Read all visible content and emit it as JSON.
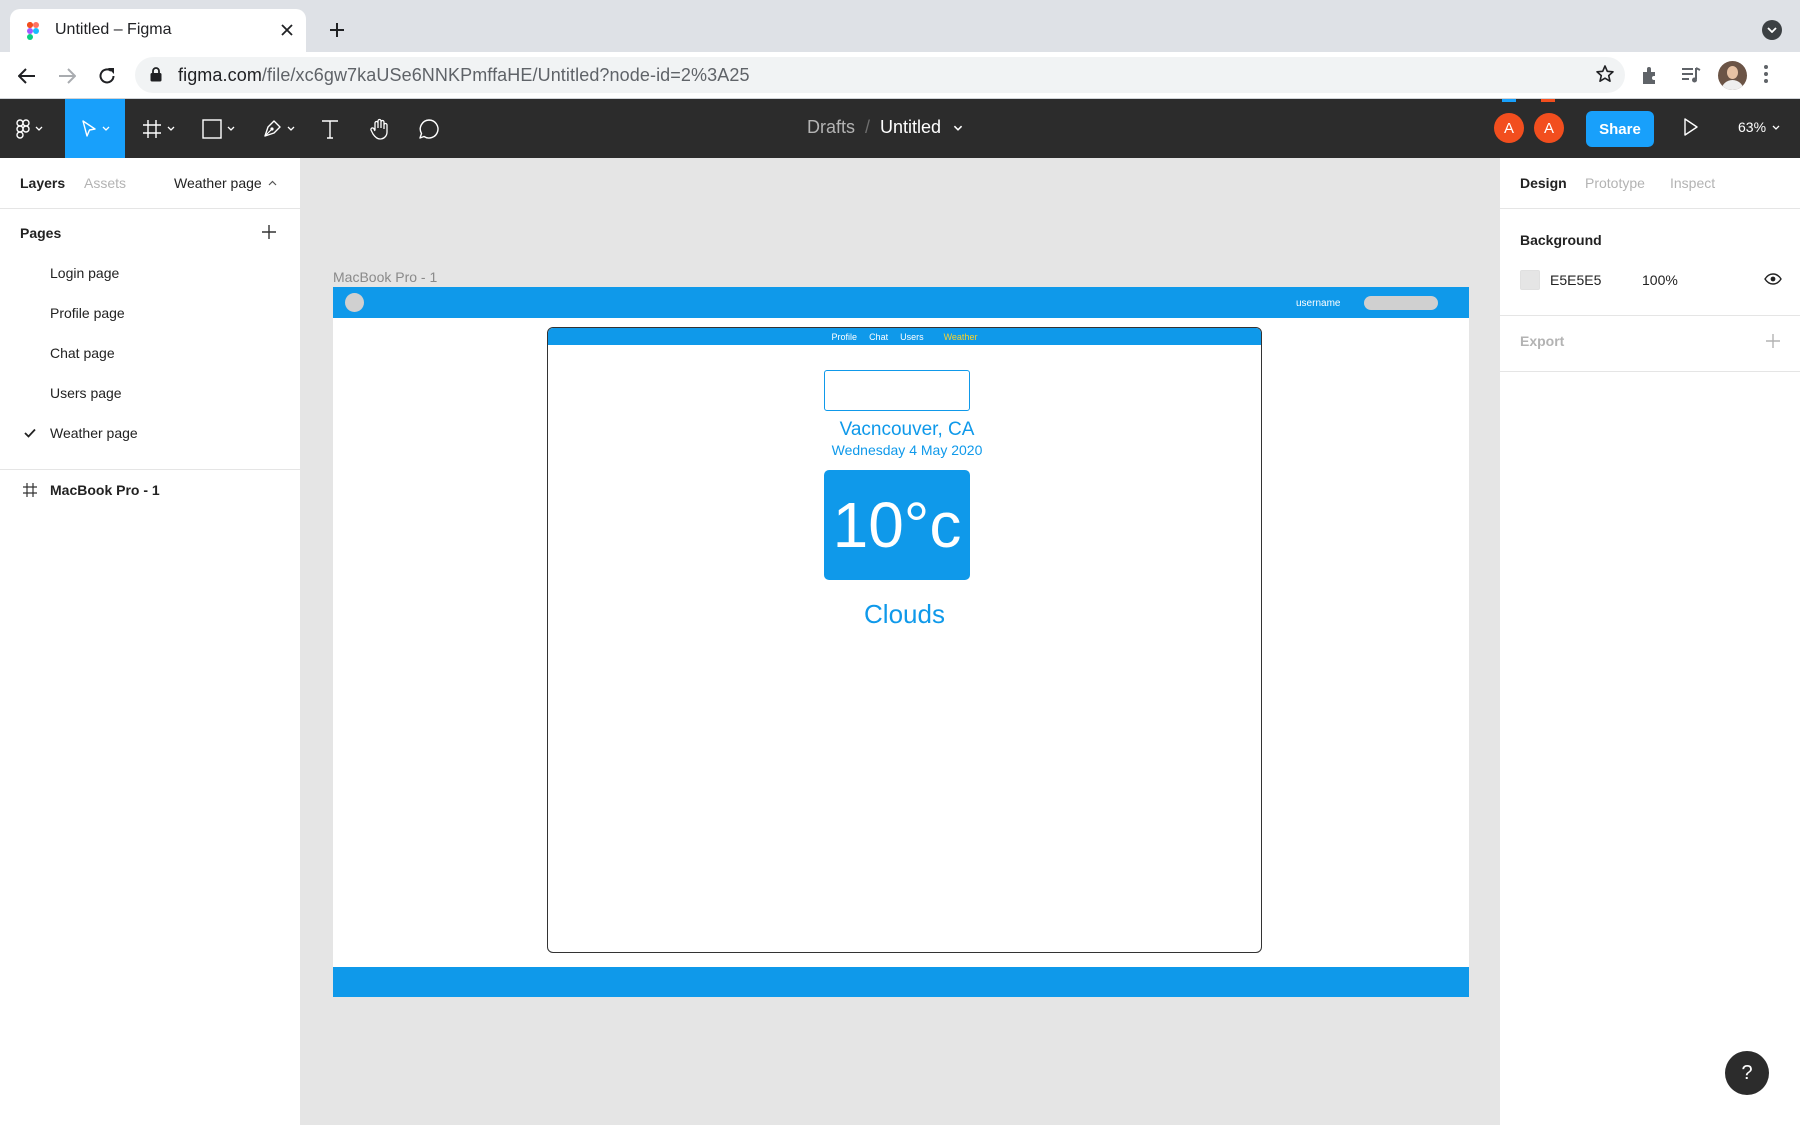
{
  "browser": {
    "tab_title": "Untitled – Figma",
    "url_host": "figma.com",
    "url_path": "/file/xc6gw7kaUSe6NNKPmffaHE/Untitled?node-id=2%3A25"
  },
  "figma_toolbar": {
    "breadcrumb_project": "Drafts",
    "breadcrumb_separator": "/",
    "file_name": "Untitled",
    "avatars": [
      "A",
      "A"
    ],
    "avatar_colors": [
      "#f24e1e",
      "#f24e1e"
    ],
    "avatar_markers": [
      "#18a0fb",
      "#f24e1e"
    ],
    "share_label": "Share",
    "zoom": "63%",
    "accent_color": "#18a0fb"
  },
  "left_panel": {
    "tabs": [
      "Layers",
      "Assets"
    ],
    "page_selector": "Weather page",
    "pages_header": "Pages",
    "pages": [
      "Login page",
      "Profile page",
      "Chat page",
      "Users page",
      "Weather page"
    ],
    "current_page_index": 4,
    "layers": [
      "MacBook Pro - 1"
    ]
  },
  "canvas": {
    "background": "#e5e5e5",
    "frame_name": "MacBook Pro - 1",
    "design": {
      "primary_color": "#0f99ea",
      "highlight_color": "#f7d22c",
      "username": "username",
      "nav": [
        "Profile",
        "Chat",
        "Users",
        "Weather"
      ],
      "active_nav": "Weather",
      "city": "Vacncouver, CA",
      "date": "Wednesday 4 May 2020",
      "temperature": "10°c",
      "condition": "Clouds"
    }
  },
  "right_panel": {
    "tabs": [
      "Design",
      "Prototype",
      "Inspect"
    ],
    "background_header": "Background",
    "background_hex": "E5E5E5",
    "background_swatch": "#e5e5e5",
    "background_opacity": "100%",
    "export_header": "Export"
  },
  "help_label": "?"
}
